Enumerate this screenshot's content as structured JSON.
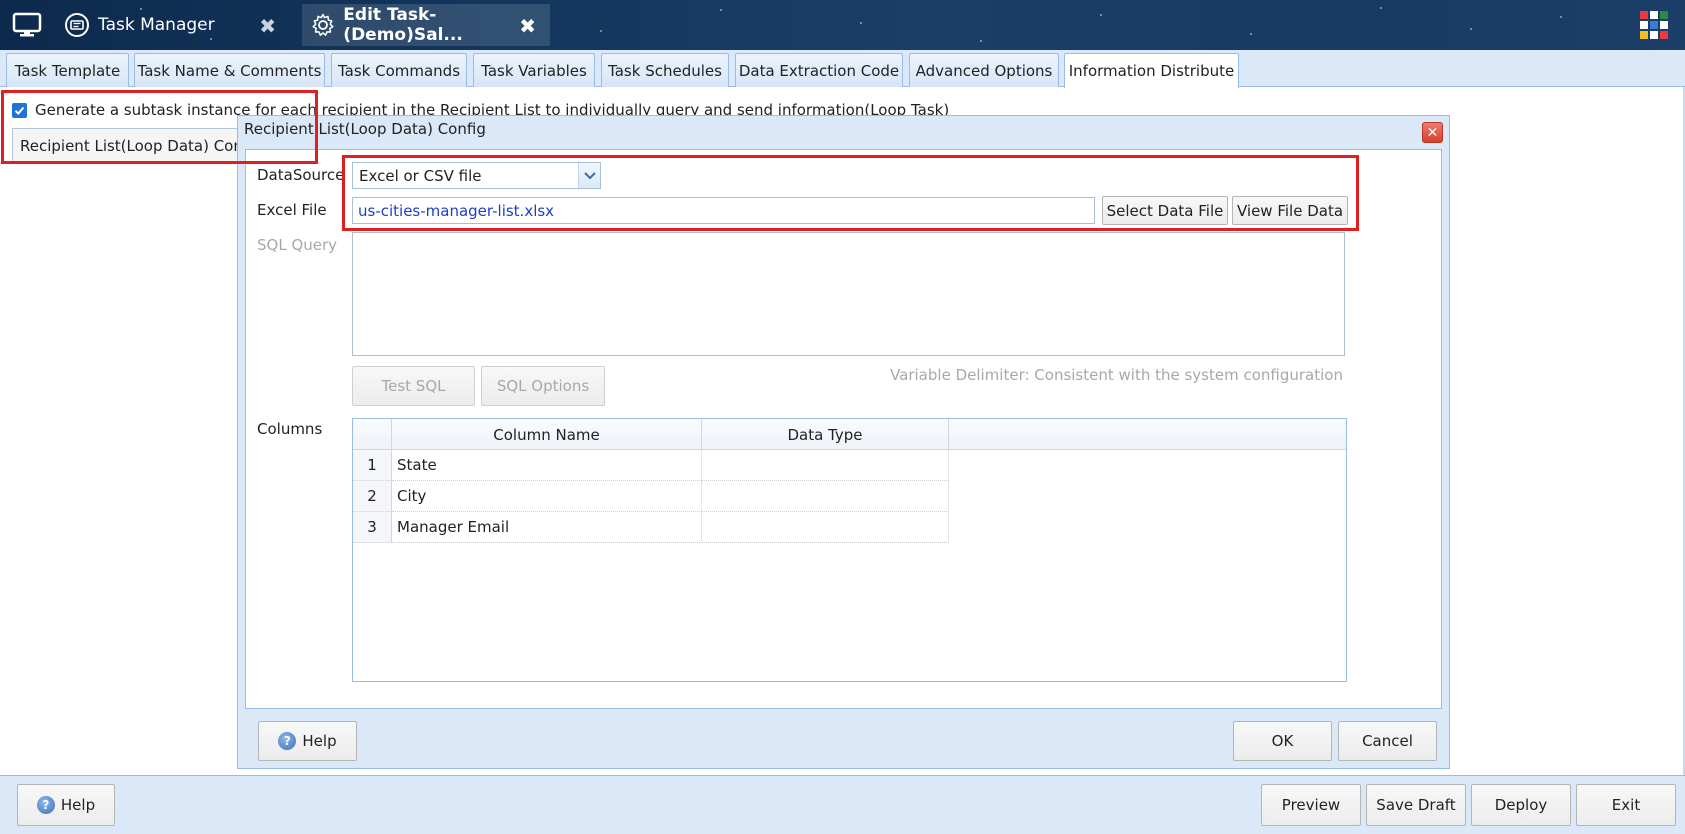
{
  "titlebar": {
    "tabs": [
      {
        "label": "Task Manager",
        "icon": "task-manager-icon"
      },
      {
        "label": "Edit Task-(Demo)Sal...",
        "icon": "gear-icon"
      }
    ],
    "close_glyph": "✖"
  },
  "main_tabs": [
    {
      "label": "Task Template"
    },
    {
      "label": "Task Name & Comments"
    },
    {
      "label": "Task Commands"
    },
    {
      "label": "Task Variables"
    },
    {
      "label": "Task Schedules"
    },
    {
      "label": "Data Extraction Code"
    },
    {
      "label": "Advanced Options"
    },
    {
      "label": "Information Distribute",
      "active": true
    }
  ],
  "background": {
    "loop_checkbox_label": "Generate a subtask instance for each recipient in the Recipient List to individually query and send information(Loop Task)",
    "loop_checked": true,
    "recipient_button": "Recipient List(Loop Data) Config"
  },
  "dialog": {
    "title": "Recipient List(Loop Data) Config",
    "datasource_label": "DataSource",
    "datasource_value": "Excel or CSV file",
    "excel_file_label": "Excel File",
    "excel_file_value": "us-cities-manager-list.xlsx",
    "select_file_button": "Select Data File",
    "view_file_button": "View File Data",
    "sql_query_label": "SQL Query",
    "sql_query_value": "",
    "test_sql_button": "Test SQL",
    "sql_options_button": "SQL Options",
    "delimiter_note": "Variable Delimiter: Consistent with the system configuration",
    "columns_label": "Columns",
    "columns_headers": [
      "Column Name",
      "Data Type"
    ],
    "columns_rows": [
      {
        "num": "1",
        "name": "State",
        "type": ""
      },
      {
        "num": "2",
        "name": "City",
        "type": ""
      },
      {
        "num": "3",
        "name": "Manager Email",
        "type": ""
      }
    ],
    "help_button": "Help",
    "ok_button": "OK",
    "cancel_button": "Cancel"
  },
  "bottombar": {
    "help_button": "Help",
    "preview_button": "Preview",
    "save_draft_button": "Save Draft",
    "deploy_button": "Deploy",
    "exit_button": "Exit"
  },
  "colors": {
    "highlight": "#e02020",
    "accent": "#1e73d9",
    "file_text": "#1d3ec6"
  }
}
